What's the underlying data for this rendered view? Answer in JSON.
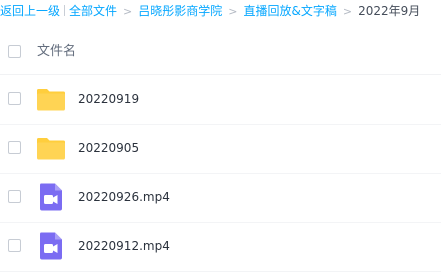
{
  "colors": {
    "link": "#06a7ff",
    "folder": "#ffd454",
    "video_icon": "#7b6cf2"
  },
  "breadcrumb": {
    "back": "返回上一级",
    "all_files": "全部文件",
    "level_1": "吕晓彤影商学院",
    "level_2": "直播回放&文字稿",
    "current": "2022年9月"
  },
  "list": {
    "header_label": "文件名",
    "rows": [
      {
        "name": "20220919",
        "icon": "folder-icon"
      },
      {
        "name": "20220905",
        "icon": "folder-icon"
      },
      {
        "name": "20220926.mp4",
        "icon": "video-file-icon"
      },
      {
        "name": "20220912.mp4",
        "icon": "video-file-icon"
      }
    ]
  }
}
